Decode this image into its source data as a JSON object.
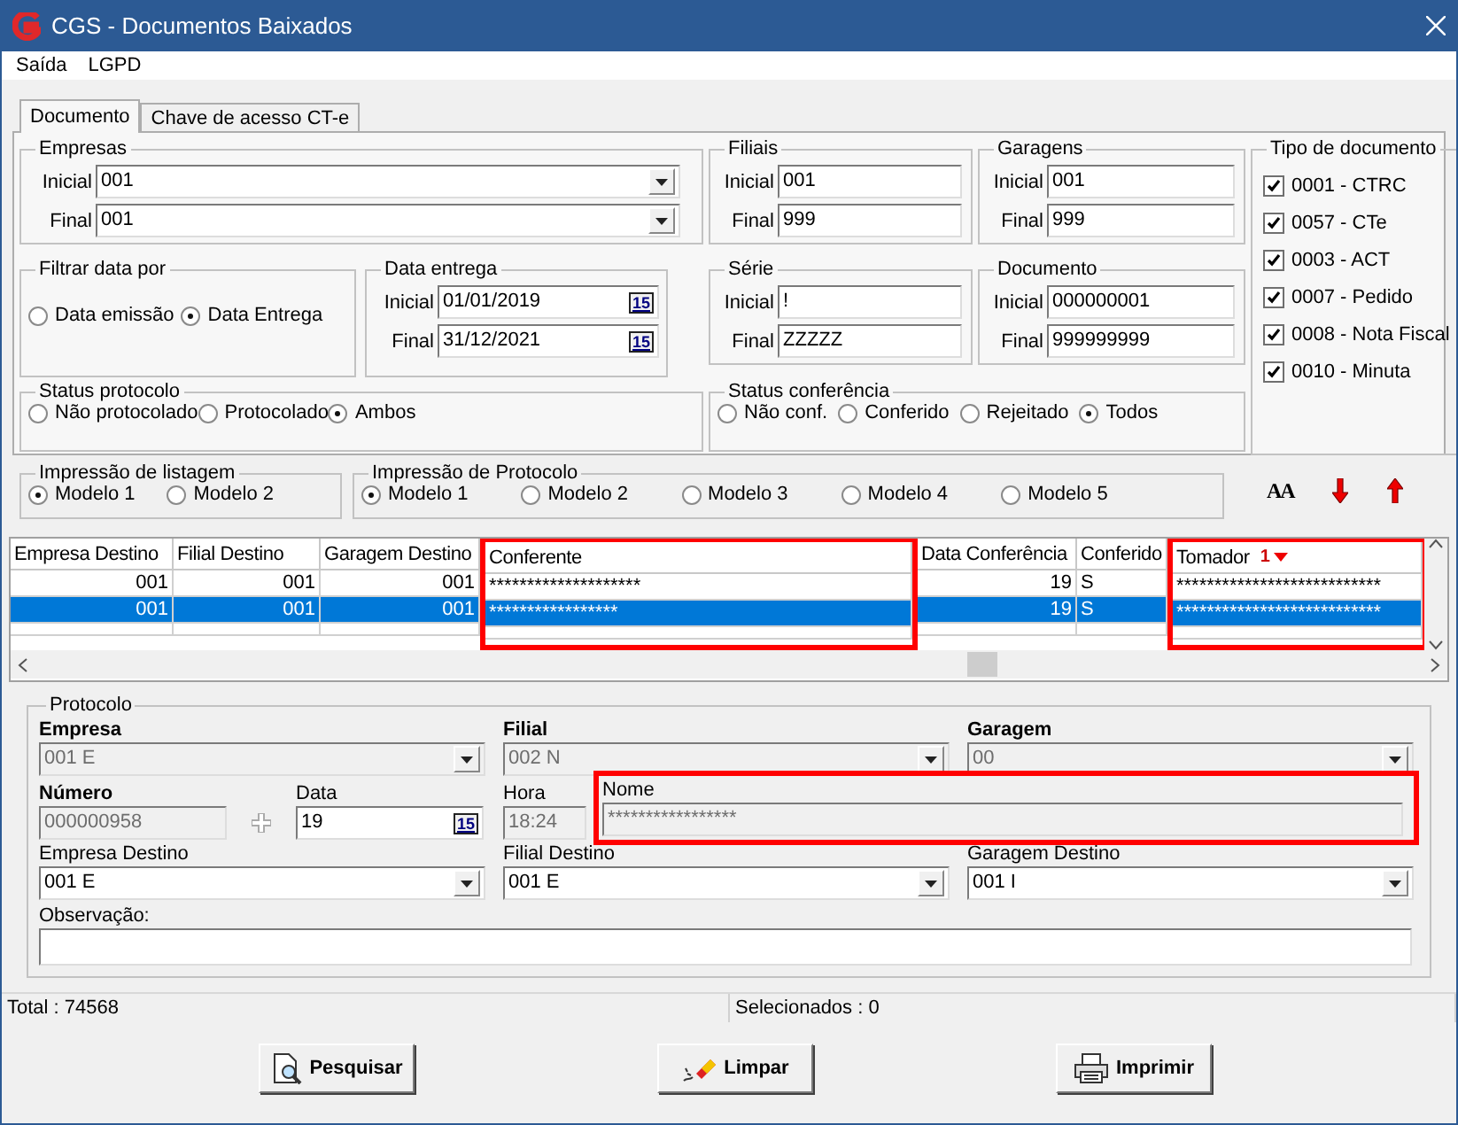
{
  "window": {
    "title": "CGS - Documentos Baixados"
  },
  "menu": [
    "Saída",
    "LGPD"
  ],
  "tabs": [
    {
      "label": "Documento",
      "selected": true
    },
    {
      "label": "Chave de acesso CT-e",
      "selected": false
    }
  ],
  "empresas": {
    "title": "Empresas",
    "fields": [
      {
        "label": "Inicial",
        "value": "001"
      },
      {
        "label": "Final",
        "value": "001"
      }
    ]
  },
  "filtrar_data": {
    "title": "Filtrar data por",
    "options": [
      {
        "label": "Data emissão",
        "selected": false
      },
      {
        "label": "Data Entrega",
        "selected": true
      }
    ]
  },
  "data_entrega": {
    "title": "Data entrega",
    "fields": [
      {
        "label": "Inicial",
        "value": "01/01/2019",
        "calendar": "15"
      },
      {
        "label": "Final",
        "value": "31/12/2021",
        "calendar": "15"
      }
    ]
  },
  "status_protocolo": {
    "title": "Status protocolo",
    "options": [
      {
        "label": "Não protocolado",
        "selected": false
      },
      {
        "label": "Protocolado",
        "selected": false
      },
      {
        "label": "Ambos",
        "selected": true
      }
    ]
  },
  "filiais": {
    "title": "Filiais",
    "fields": [
      {
        "label": "Inicial",
        "value": "001"
      },
      {
        "label": "Final",
        "value": "999"
      }
    ]
  },
  "garagens": {
    "title": "Garagens",
    "fields": [
      {
        "label": "Inicial",
        "value": "001"
      },
      {
        "label": "Final",
        "value": "999"
      }
    ]
  },
  "serie": {
    "title": "Série",
    "fields": [
      {
        "label": "Inicial",
        "value": "!"
      },
      {
        "label": "Final",
        "value": "ZZZZZ"
      }
    ]
  },
  "documento": {
    "title": "Documento",
    "fields": [
      {
        "label": "Inicial",
        "value": "000000001"
      },
      {
        "label": "Final",
        "value": "999999999"
      }
    ]
  },
  "status_conferencia": {
    "title": "Status conferência",
    "options": [
      {
        "label": "Não conf.",
        "selected": false
      },
      {
        "label": "Conferido",
        "selected": false
      },
      {
        "label": "Rejeitado",
        "selected": false
      },
      {
        "label": "Todos",
        "selected": true
      }
    ]
  },
  "tipo_documento": {
    "title": "Tipo de documento",
    "items": [
      {
        "label": "0001 - CTRC",
        "checked": true
      },
      {
        "label": "0057 - CTe",
        "checked": true
      },
      {
        "label": "0003 - ACT",
        "checked": true
      },
      {
        "label": "0007 - Pedido",
        "checked": true
      },
      {
        "label": "0008 - Nota Fiscal",
        "checked": true
      },
      {
        "label": "0010 - Minuta",
        "checked": true
      }
    ]
  },
  "impressao_listagem": {
    "title": "Impressão de listagem",
    "options": [
      {
        "label": "Modelo 1",
        "selected": true
      },
      {
        "label": "Modelo 2",
        "selected": false
      }
    ]
  },
  "impressao_protocolo": {
    "title": "Impressão de Protocolo",
    "options": [
      {
        "label": "Modelo 1",
        "selected": true
      },
      {
        "label": "Modelo 2",
        "selected": false
      },
      {
        "label": "Modelo 3",
        "selected": false
      },
      {
        "label": "Modelo 4",
        "selected": false
      },
      {
        "label": "Modelo 5",
        "selected": false
      }
    ]
  },
  "font_button": "AA",
  "table": {
    "columns": [
      {
        "label": "Empresa Destino",
        "kind": "number",
        "highlighted": false
      },
      {
        "label": "Filial Destino",
        "kind": "number",
        "highlighted": false
      },
      {
        "label": "Garagem Destino",
        "kind": "number",
        "highlighted": false
      },
      {
        "label": "Conferente",
        "kind": "text",
        "highlighted": true
      },
      {
        "label": "Data Conferência",
        "kind": "number",
        "highlighted": false
      },
      {
        "label": "Conferido",
        "kind": "text",
        "highlighted": false
      },
      {
        "label": "Tomador",
        "kind": "text",
        "highlighted": true,
        "sort_rank": "1"
      }
    ],
    "rows": [
      {
        "selected": false,
        "cells": [
          "001",
          "001",
          "001",
          "********************",
          "19",
          "S",
          "***************************"
        ]
      },
      {
        "selected": true,
        "cells": [
          "001",
          "001",
          "001",
          "*****************",
          "19",
          "S",
          "***************************"
        ]
      }
    ]
  },
  "protocolo": {
    "title": "Protocolo",
    "empresa": {
      "label": "Empresa",
      "value": "001 E",
      "disabled": true
    },
    "filial": {
      "label": "Filial",
      "value": "002 N",
      "disabled": true
    },
    "garagem": {
      "label": "Garagem",
      "value": "00",
      "disabled": true
    },
    "numero": {
      "label": "Número",
      "value": "000000958",
      "disabled": true
    },
    "data": {
      "label": "Data",
      "value": "19",
      "calendar": "15",
      "disabled": false
    },
    "hora": {
      "label": "Hora",
      "value": "18:24",
      "disabled": true
    },
    "nome": {
      "label": "Nome",
      "value": "*****************",
      "disabled": true,
      "highlighted": true
    },
    "empresa_destino": {
      "label": "Empresa Destino",
      "value": "001 E",
      "disabled": false
    },
    "filial_destino": {
      "label": "Filial Destino",
      "value": "001 E",
      "disabled": false
    },
    "garagem_destino": {
      "label": "Garagem Destino",
      "value": "001 I",
      "disabled": false
    },
    "observacao": {
      "label": "Observação:"
    }
  },
  "status_bar": [
    "Total : 74568",
    "Selecionados : 0"
  ],
  "buttons": [
    {
      "label": "Pesquisar",
      "kind": "search"
    },
    {
      "label": "Limpar",
      "kind": "clear"
    },
    {
      "label": "Imprimir",
      "kind": "print"
    }
  ]
}
